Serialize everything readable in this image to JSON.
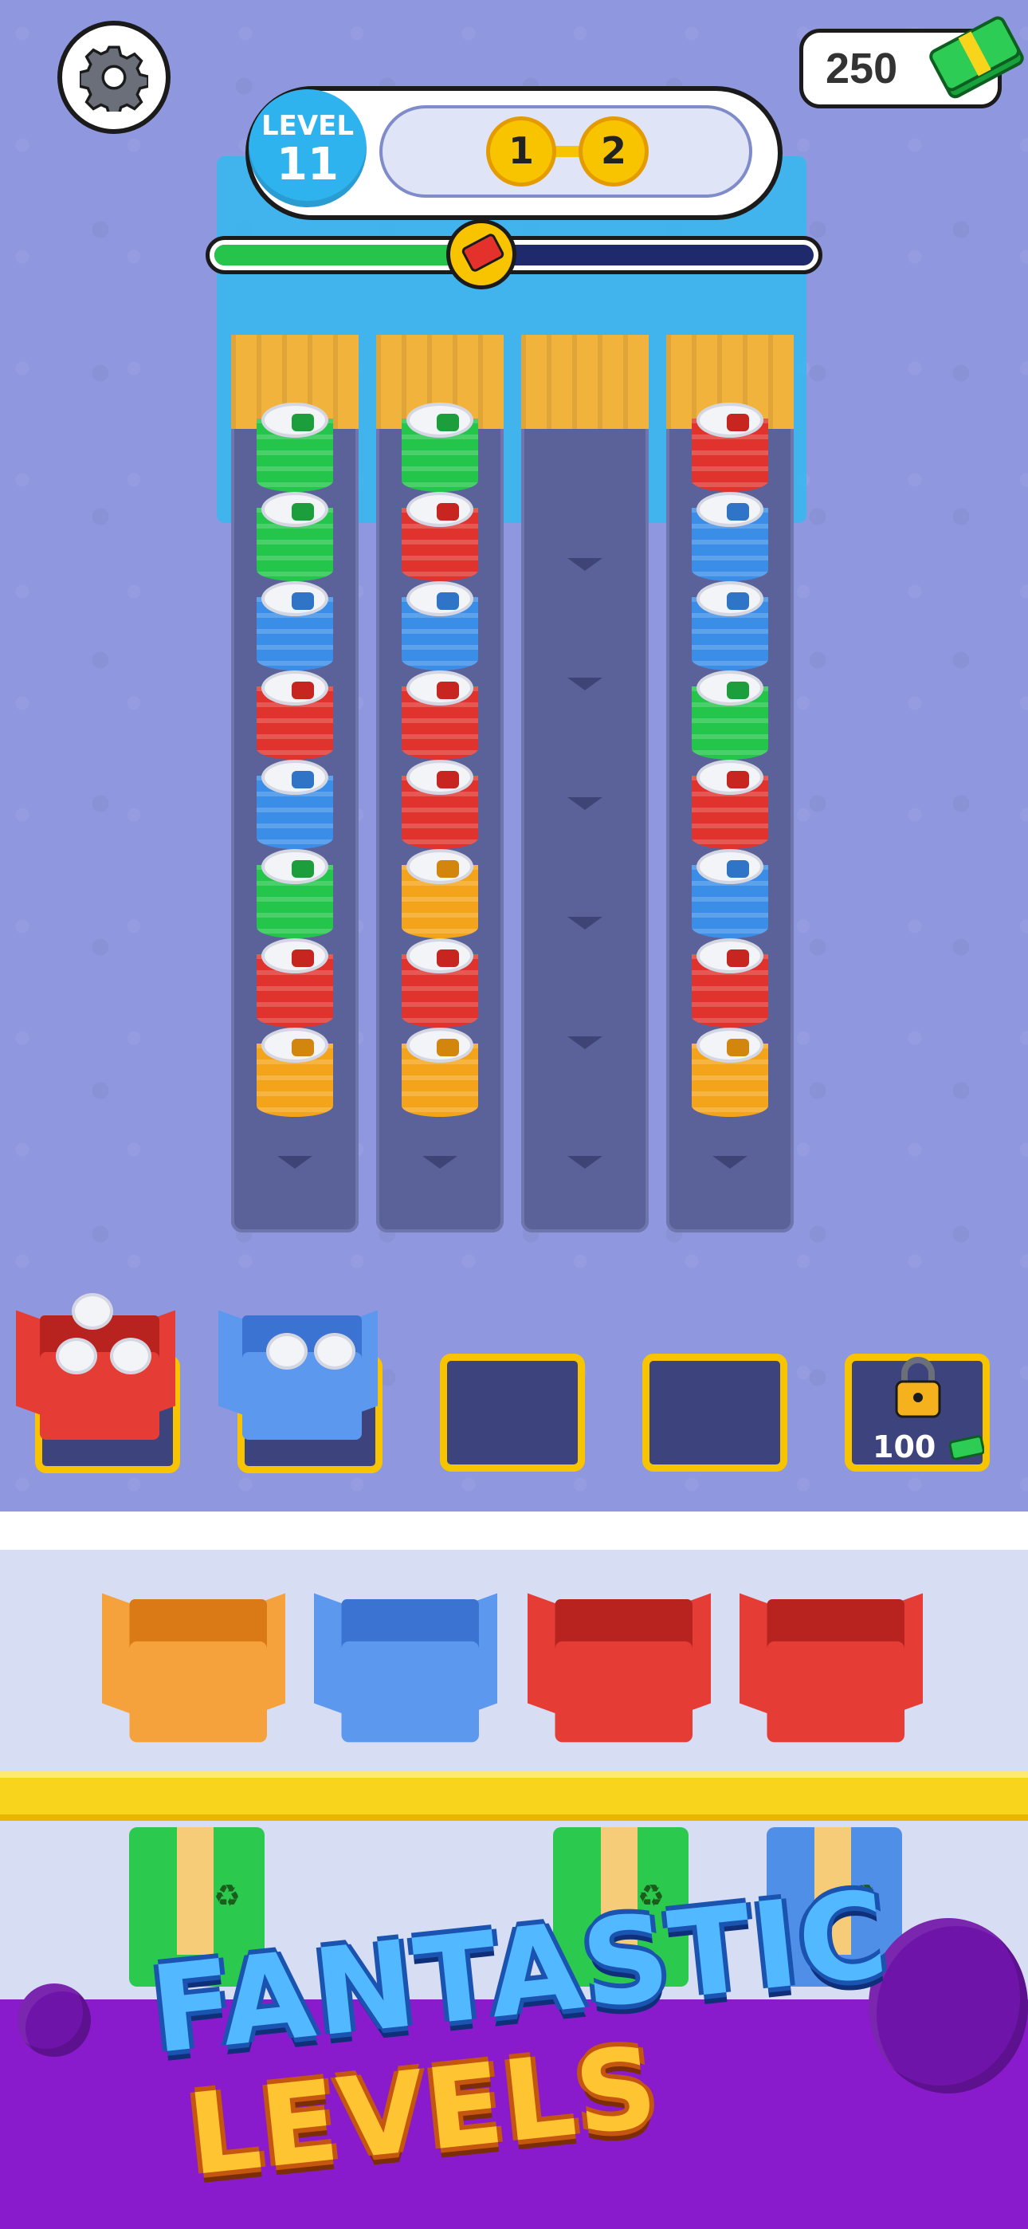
{
  "cash": {
    "value": "250"
  },
  "level": {
    "label": "LEVEL",
    "number": "11"
  },
  "stages": [
    "1",
    "2"
  ],
  "progress": {
    "fraction": 0.45
  },
  "lanes": [
    [
      "green",
      "green",
      "blue",
      "red",
      "blue",
      "green",
      "red",
      "orange"
    ],
    [
      "green",
      "red",
      "blue",
      "red",
      "red",
      "orange",
      "red",
      "orange"
    ],
    [],
    [
      "red",
      "blue",
      "blue",
      "green",
      "red",
      "blue",
      "red",
      "orange"
    ]
  ],
  "buffer": [
    {
      "type": "box",
      "color": "red",
      "cans": 3
    },
    {
      "type": "box",
      "color": "blue",
      "cans": 2
    },
    {
      "type": "empty"
    },
    {
      "type": "empty"
    },
    {
      "type": "locked",
      "price": "100"
    }
  ],
  "staging_boxes": [
    "orange",
    "blue",
    "red",
    "red"
  ],
  "closed_boxes": [
    "green",
    "green",
    "blue"
  ],
  "promo": {
    "line1": "FANTASTIC",
    "line2": "LEVELS"
  },
  "colors": {
    "green": "#23c54a",
    "red": "#e1332d",
    "blue": "#3a8ee8",
    "orange": "#f4a41a",
    "accent": "#f8c400"
  }
}
